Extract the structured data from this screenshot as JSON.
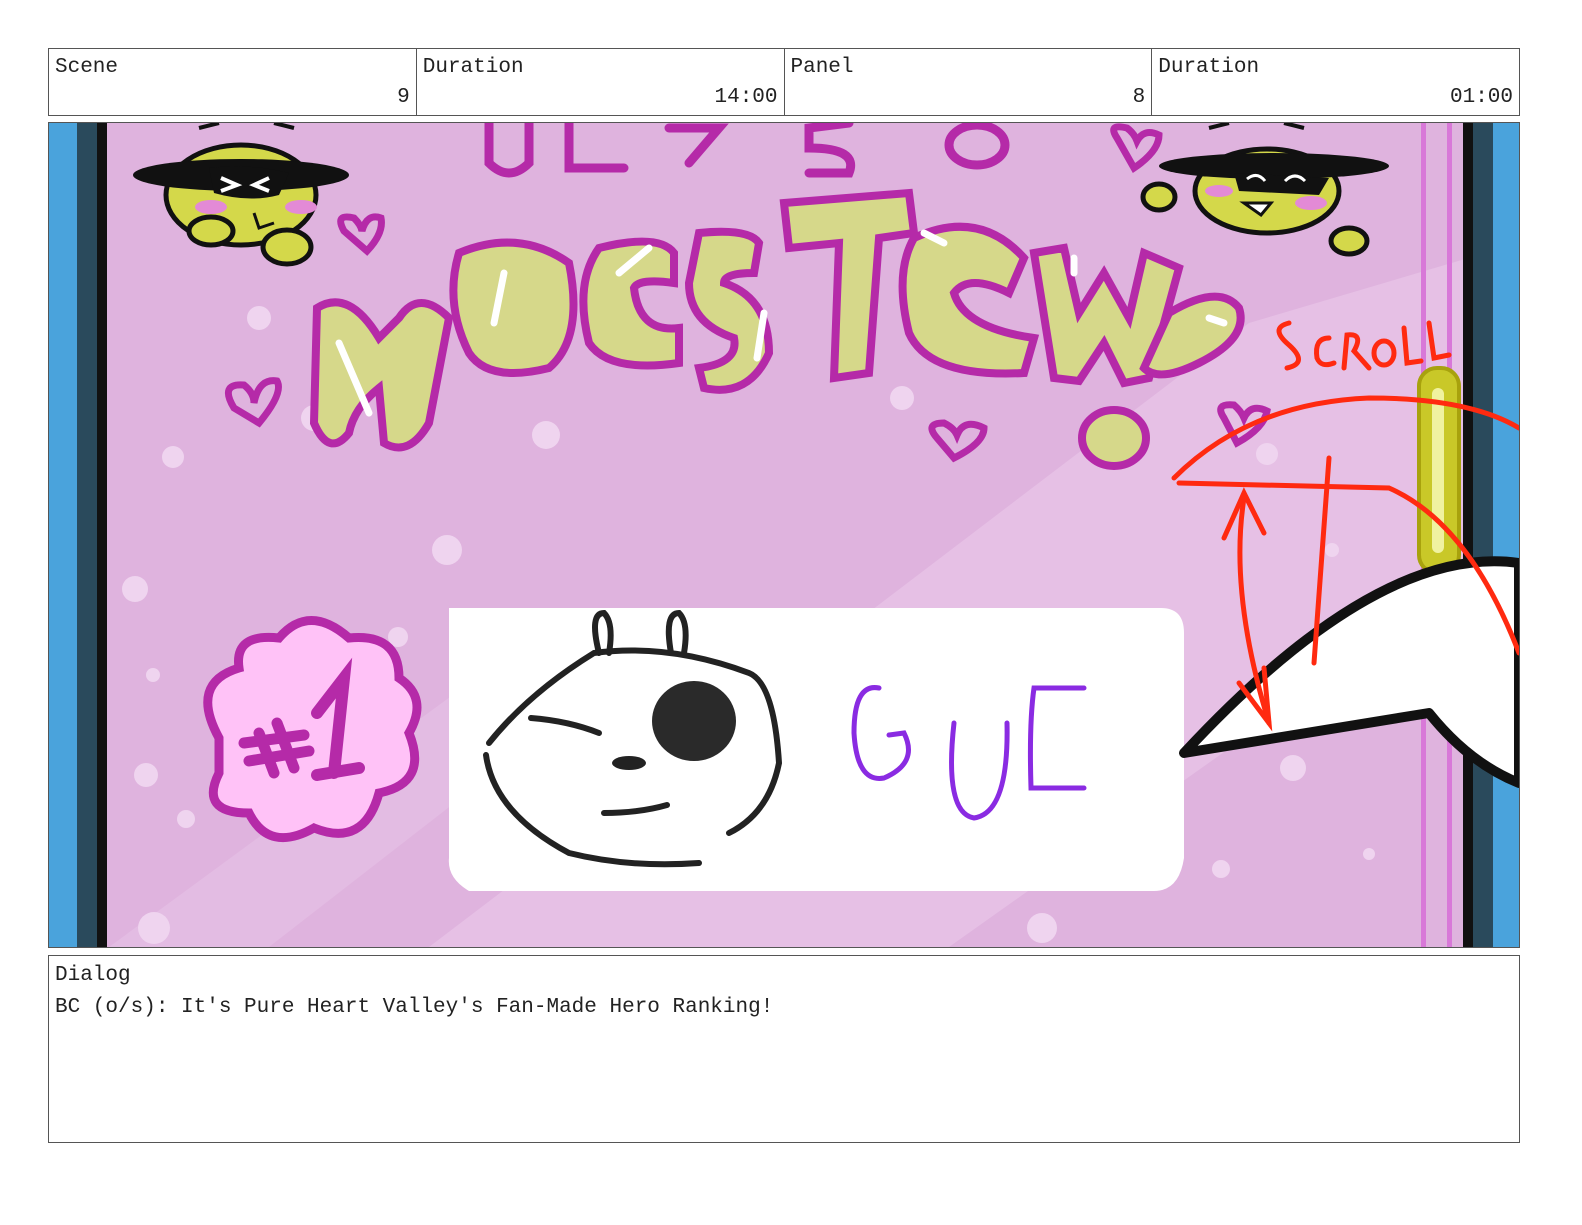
{
  "header": {
    "scene_label": "Scene",
    "scene_value": "9",
    "scene_duration_label": "Duration",
    "scene_duration_value": "14:00",
    "panel_label": "Panel",
    "panel_value": "8",
    "panel_duration_label": "Duration",
    "panel_duration_value": "01:00"
  },
  "artwork": {
    "banner_text": "HOGSTEW!",
    "badge_text": "#1",
    "card_text": "GUC",
    "note_text": "SCROLL",
    "colors": {
      "background": "#dfb3de",
      "frame_blue": "#4aa3dc",
      "frame_dark": "#2a4a5c",
      "magenta_outline": "#b52aa8",
      "yellow_fill": "#d6d88a",
      "note_red": "#ff2a10",
      "card_purple": "#8a2be2"
    }
  },
  "dialog": {
    "label": "Dialog",
    "text": "BC (o/s): It's Pure Heart Valley's Fan-Made Hero Ranking!"
  }
}
